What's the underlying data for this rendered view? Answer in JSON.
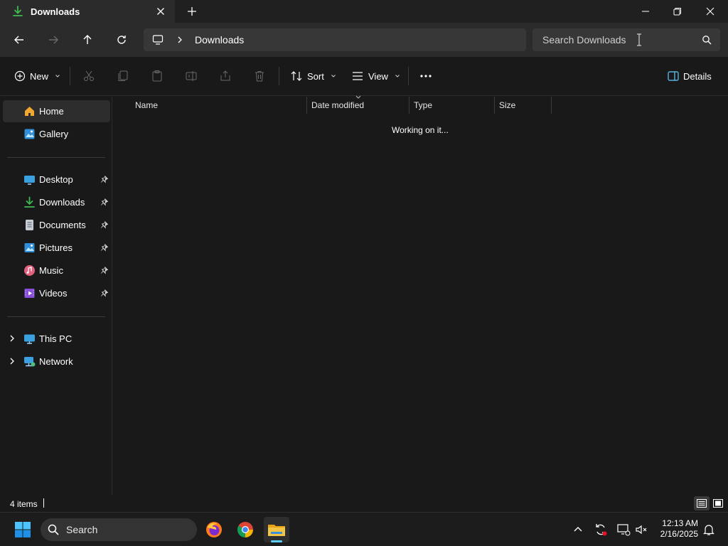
{
  "window": {
    "tab_title": "Downloads",
    "new_tab": "+"
  },
  "address": {
    "crumbs": [
      "Downloads"
    ],
    "search_placeholder": "Search Downloads"
  },
  "toolbar": {
    "new_label": "New",
    "sort_label": "Sort",
    "view_label": "View",
    "more_label": "...",
    "details_label": "Details"
  },
  "sidebar": {
    "items": [
      {
        "label": "Home",
        "icon": "home-icon",
        "selected": true
      },
      {
        "label": "Gallery",
        "icon": "gallery-icon"
      },
      {
        "label": "Desktop",
        "icon": "desktop-icon",
        "pinned": true
      },
      {
        "label": "Downloads",
        "icon": "download-icon",
        "pinned": true
      },
      {
        "label": "Documents",
        "icon": "documents-icon",
        "pinned": true
      },
      {
        "label": "Pictures",
        "icon": "pictures-icon",
        "pinned": true
      },
      {
        "label": "Music",
        "icon": "music-icon",
        "pinned": true
      },
      {
        "label": "Videos",
        "icon": "videos-icon",
        "pinned": true
      },
      {
        "label": "This PC",
        "icon": "this-pc-icon",
        "expandable": true
      },
      {
        "label": "Network",
        "icon": "network-icon",
        "expandable": true
      }
    ]
  },
  "content": {
    "columns": [
      "Name",
      "Date modified",
      "Type",
      "Size"
    ],
    "status_message": "Working on it..."
  },
  "statusbar": {
    "item_count": "4 items"
  },
  "taskbar": {
    "search_label": "Search",
    "apps": [
      "firefox",
      "chrome",
      "file-explorer"
    ],
    "time": "12:13 AM",
    "date": "2/16/2025"
  },
  "colors": {
    "accent": "#60cdff",
    "download_green": "#3fb950",
    "folder_yellow": "#f4c542"
  }
}
